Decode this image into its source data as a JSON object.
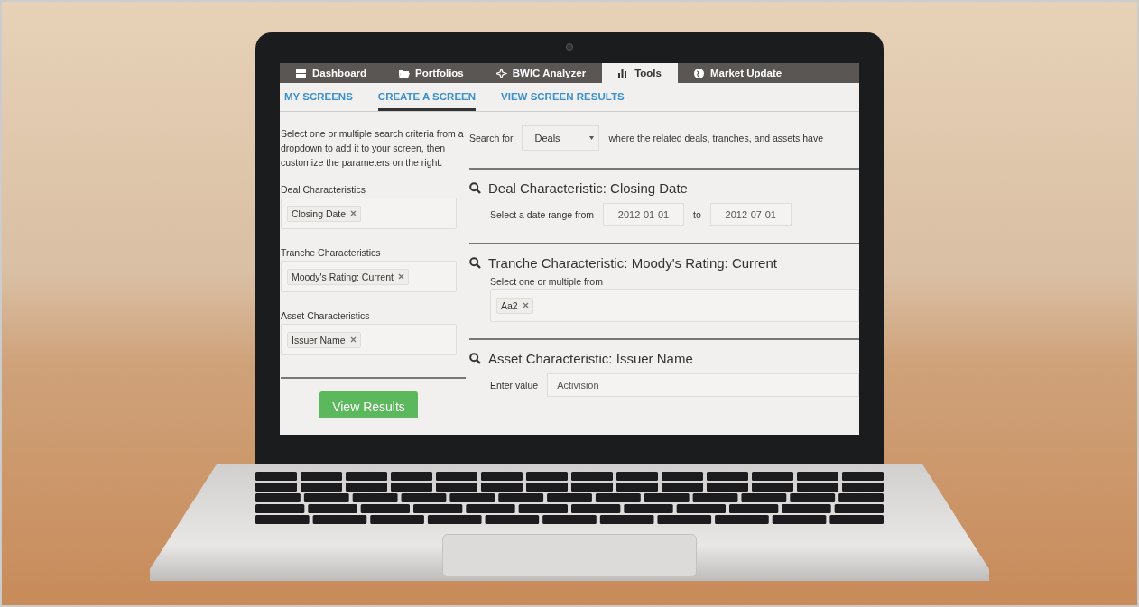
{
  "tabs": [
    {
      "label": "Dashboard",
      "selected": false
    },
    {
      "label": "Portfolios",
      "selected": false
    },
    {
      "label": "BWIC Analyzer",
      "selected": false
    },
    {
      "label": "Tools",
      "selected": true
    },
    {
      "label": "Market Update",
      "selected": false
    }
  ],
  "subnav": [
    {
      "label": "MY SCREENS",
      "selected": false
    },
    {
      "label": "CREATE A SCREEN",
      "selected": true
    },
    {
      "label": "VIEW SCREEN RESULTS",
      "selected": false
    }
  ],
  "sidebar": {
    "intro": "Select one or multiple search criteria from a dropdown to add it to your screen, then customize the parameters on the right.",
    "groups": [
      {
        "label": "Deal Characteristics",
        "tags": [
          "Closing Date"
        ]
      },
      {
        "label": "Tranche Characteristics",
        "tags": [
          "Moody's Rating: Current"
        ]
      },
      {
        "label": "Asset Characteristics",
        "tags": [
          "Issuer Name"
        ]
      }
    ],
    "button": "View Results"
  },
  "search_bar": {
    "label": "Search for",
    "select": "Deals",
    "suffix": "where the related deals, tranches, and assets have"
  },
  "criteria": [
    {
      "kind": "date_range",
      "title": "Deal Characteristic: Closing Date",
      "label": "Select a date range from",
      "from": "2012-01-01",
      "joiner": "to",
      "to": "2012-07-01"
    },
    {
      "kind": "multi_select",
      "title": "Tranche Characteristic: Moody's Rating: Current",
      "label": "Select one or multiple from",
      "tags": [
        "Aa2"
      ]
    },
    {
      "kind": "text",
      "title": "Asset Characteristic: Issuer Name",
      "label": "Enter value",
      "value": "Activision"
    }
  ]
}
